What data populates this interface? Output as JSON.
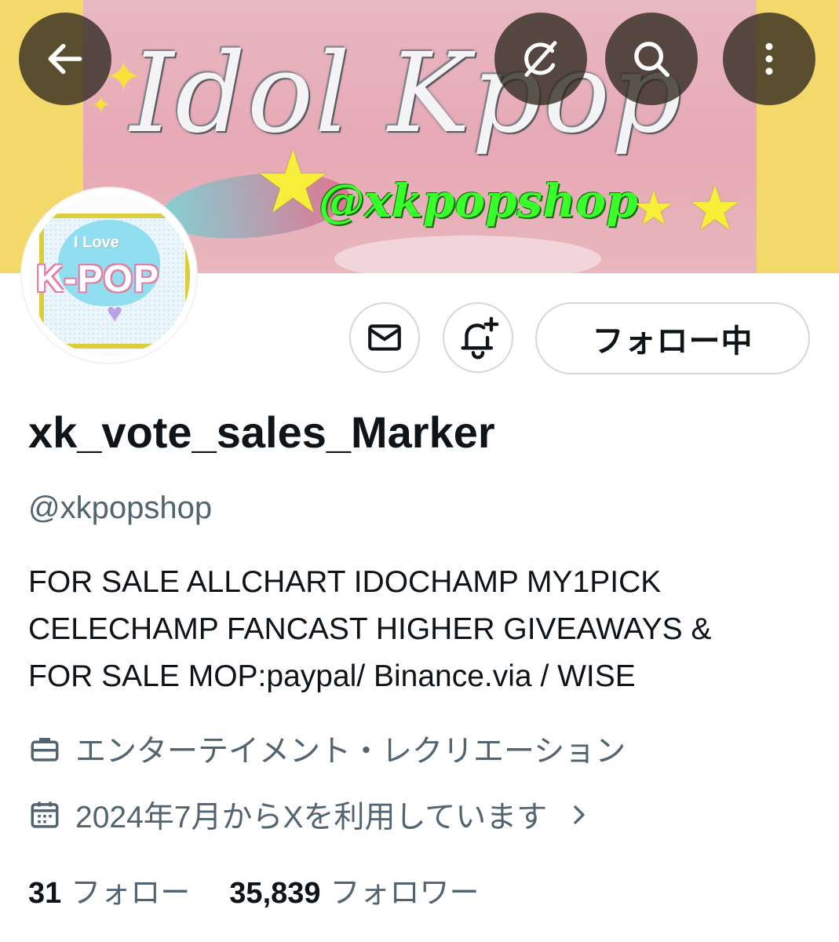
{
  "banner": {
    "title": "Idol Kpop",
    "handle": "@xkpopshop"
  },
  "top_buttons": {
    "back_icon": "arrow-left-icon",
    "grok_icon": "grok-icon",
    "search_icon": "search-icon",
    "more_icon": "more-vertical-icon"
  },
  "avatar": {
    "line1": "I Love",
    "line2": "K-POP"
  },
  "actions": {
    "message_icon": "mail-icon",
    "notify_icon": "bell-plus-icon",
    "follow_label": "フォロー中"
  },
  "profile": {
    "display_name": "xk_vote_sales_Marker",
    "handle": "@xkpopshop",
    "bio": [
      "FOR SALE ALLCHART IDOCHAMP MY1PICK",
      "CELECHAMP FANCAST HIGHER GIVEAWAYS &",
      "FOR SALE MOP:paypal/ Binance.via / WISE"
    ],
    "category": "エンターテイメント・レクリエーション",
    "joined": "2024年7月からXを利用しています"
  },
  "stats": {
    "following_count": "31",
    "following_label": "フォロー",
    "followers_count": "35,839",
    "followers_label": "フォロワー"
  },
  "colors": {
    "banner_bg": "#f3d86a",
    "text_primary": "#0f1419",
    "text_secondary": "#536471",
    "border": "#cfd9de"
  }
}
